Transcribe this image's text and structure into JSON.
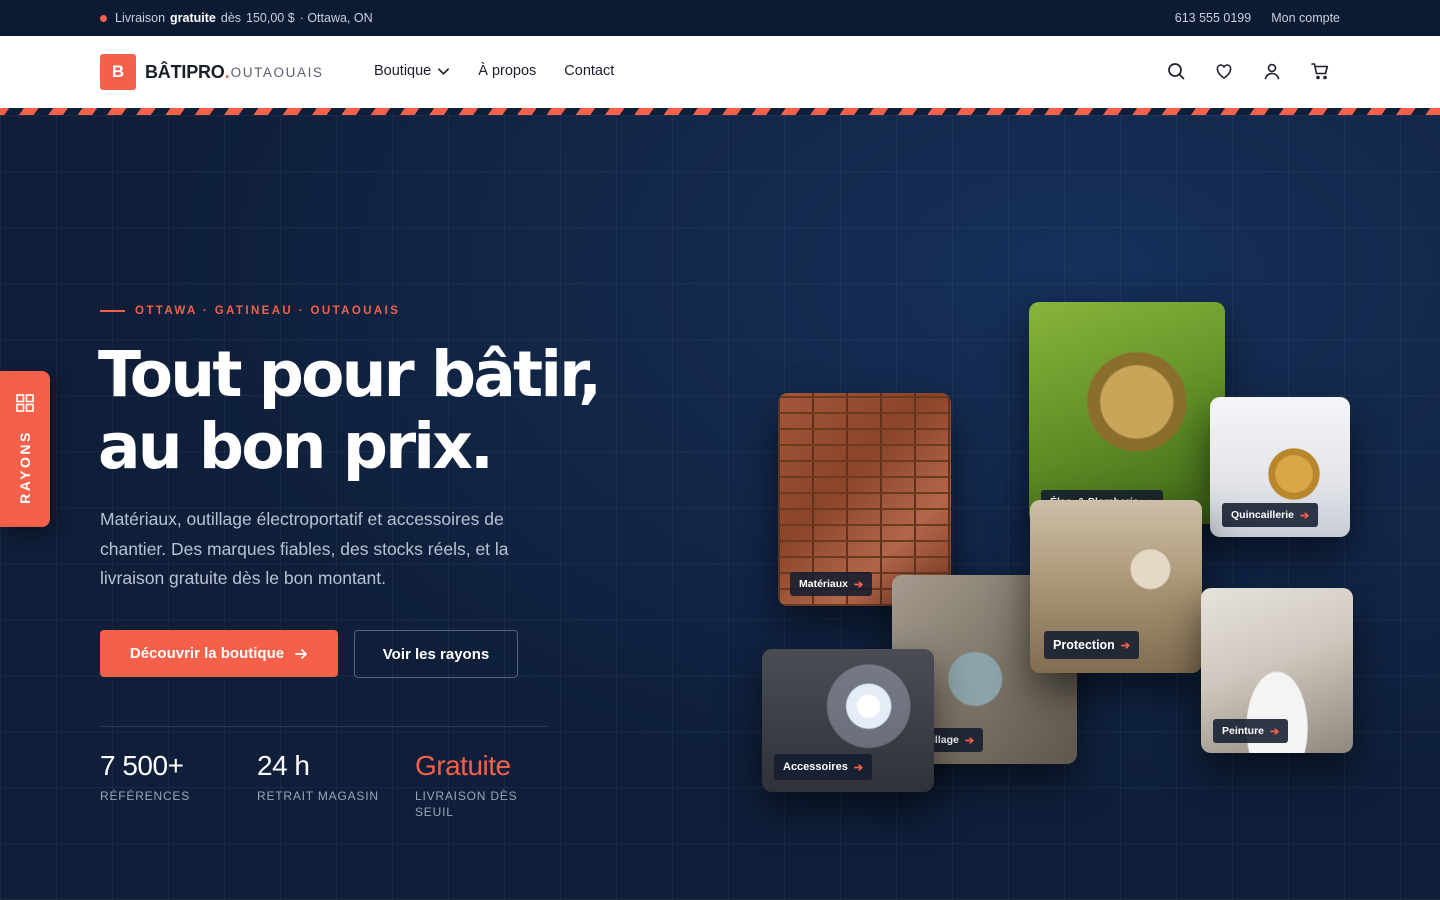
{
  "topbar": {
    "delivery_prefix": "Livraison",
    "delivery_emphasis": "gratuite",
    "delivery_threshold_prefix": "dès",
    "delivery_amount": "150,00 $",
    "location": "· Ottawa, ON",
    "phone": "613 555 0199",
    "account": "Mon compte",
    "status_color": "#f4604a"
  },
  "header": {
    "logo_letter": "B",
    "logo_name": "BÂTIPRO",
    "logo_dot": ".",
    "logo_sub": "OUTAOUAIS",
    "nav": [
      {
        "label": "Boutique",
        "has_dropdown": true
      },
      {
        "label": "À propos"
      },
      {
        "label": "Contact"
      }
    ],
    "icons": [
      "search-icon",
      "heart-icon",
      "user-icon",
      "cart-icon"
    ]
  },
  "side_tab": {
    "label": "RAYONS",
    "icon": "grid-icon"
  },
  "hero": {
    "eyebrow": "OTTAWA · GATINEAU · OUTAOUAIS",
    "headline_line1": "Tout pour bâtir,",
    "headline_line2": "au bon prix.",
    "lead": "Matériaux, outillage électroportatif et accessoires de chantier. Des marques fiables, des stocks réels, et la livraison gratuite dès le bon montant.",
    "cta_primary": "Découvrir la boutique",
    "cta_secondary": "Voir les rayons",
    "stats": [
      {
        "value": "7 500+",
        "label": "RÉFÉRENCES"
      },
      {
        "value": "24 h",
        "label": "RETRAIT MAGASIN"
      },
      {
        "value": "Gratuite",
        "label": "LIVRAISON DÈS SEUIL"
      }
    ]
  },
  "collage": {
    "materiaux": "Matériaux",
    "plomberie": "Élec. & Plomberie",
    "quincaillerie": "Quincaillerie",
    "outillage": "illage",
    "protection": "Protection",
    "peinture": "Peinture",
    "accessoires": "Accessoires"
  },
  "colors": {
    "accent": "#f4604a",
    "navy": "#0f1f3a",
    "topbar": "#0c1a33"
  }
}
